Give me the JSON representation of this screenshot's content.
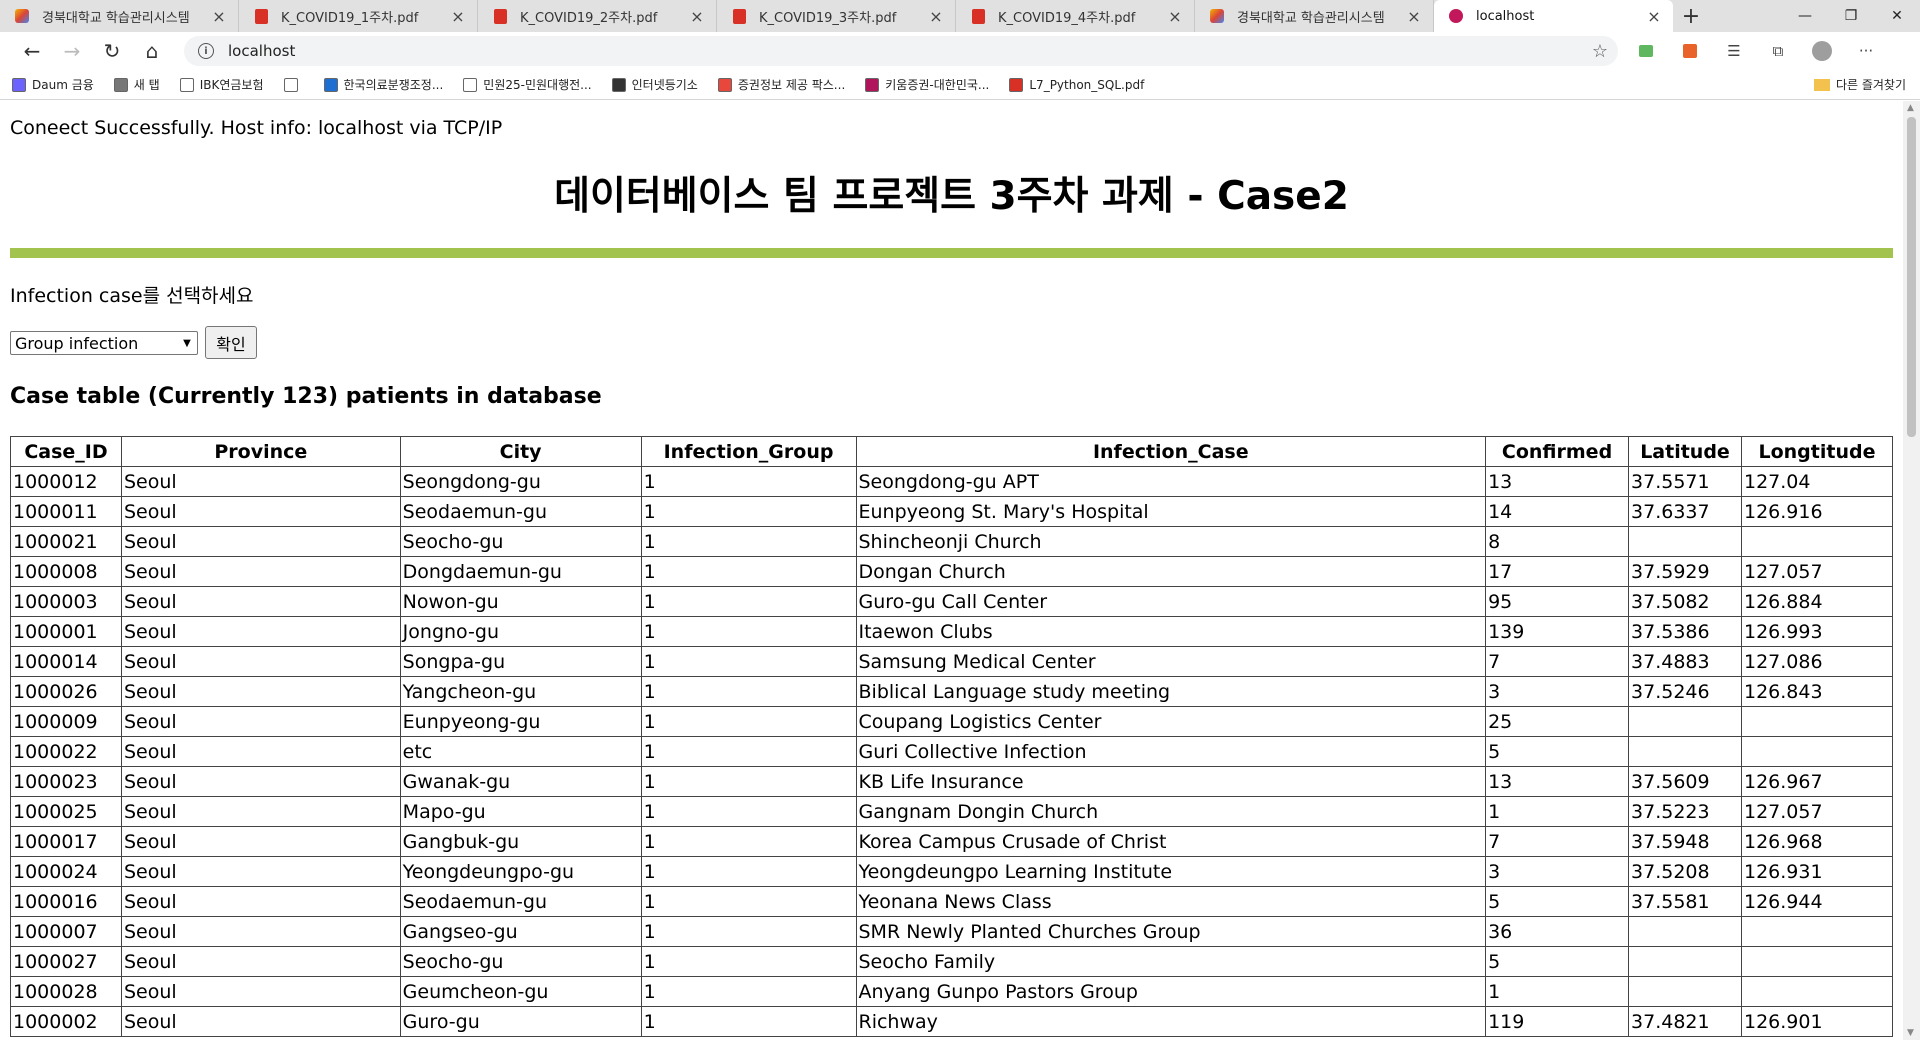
{
  "browser": {
    "tabs": [
      {
        "title": "경북대학교 학습관리시스템",
        "icon": "lms-icon",
        "active": false
      },
      {
        "title": "K_COVID19_1주차.pdf",
        "icon": "pdf-icon",
        "active": false
      },
      {
        "title": "K_COVID19_2주차.pdf",
        "icon": "pdf-icon",
        "active": false
      },
      {
        "title": "K_COVID19_3주차.pdf",
        "icon": "pdf-icon",
        "active": false
      },
      {
        "title": "K_COVID19_4주차.pdf",
        "icon": "pdf-icon",
        "active": false
      },
      {
        "title": "경북대학교 학습관리시스템",
        "icon": "lms-icon",
        "active": false
      },
      {
        "title": "localhost",
        "icon": "localhost-icon",
        "active": true
      }
    ],
    "address": "localhost",
    "bookmarks": [
      {
        "label": "Daum 금융",
        "color": "#6c63ff"
      },
      {
        "label": "새 탭",
        "color": "#777777"
      },
      {
        "label": "IBK연금보험",
        "color": "#ffffff"
      },
      {
        "label": "",
        "color": "#ffffff"
      },
      {
        "label": "한국의료분쟁조정...",
        "color": "#1d6fd1"
      },
      {
        "label": "민원25-민원대행전...",
        "color": "#ffffff"
      },
      {
        "label": "인터넷등기소",
        "color": "#333333"
      },
      {
        "label": "증권정보 제공 팍스...",
        "color": "#e8473c"
      },
      {
        "label": "키움증권-대한민국...",
        "color": "#b0145a"
      },
      {
        "label": "L7_Python_SQL.pdf",
        "color": "#d93025"
      }
    ],
    "other_bookmarks": "다른 즐겨찾기"
  },
  "page": {
    "connect_message": "Coneect Successfully. Host info: localhost via TCP/IP",
    "title": "데이터베이스 팀 프로젝트 3주차 과제 - Case2",
    "accent_color": "#a2c44f",
    "select_prompt": "Infection case를 선택하세요",
    "selected_option": "Group infection",
    "confirm_label": "확인",
    "table_heading": "Case table (Currently 123) patients in database"
  },
  "table": {
    "headers": [
      "Case_ID",
      "Province",
      "City",
      "Infection_Group",
      "Infection_Case",
      "Confirmed",
      "Latitude",
      "Longtitude"
    ],
    "rows": [
      [
        "1000012",
        "Seoul",
        "Seongdong-gu",
        "1",
        "Seongdong-gu APT",
        "13",
        "37.5571",
        "127.04"
      ],
      [
        "1000011",
        "Seoul",
        "Seodaemun-gu",
        "1",
        "Eunpyeong St. Mary's Hospital",
        "14",
        "37.6337",
        "126.916"
      ],
      [
        "1000021",
        "Seoul",
        "Seocho-gu",
        "1",
        "Shincheonji Church",
        "8",
        "",
        ""
      ],
      [
        "1000008",
        "Seoul",
        "Dongdaemun-gu",
        "1",
        "Dongan Church",
        "17",
        "37.5929",
        "127.057"
      ],
      [
        "1000003",
        "Seoul",
        "Nowon-gu",
        "1",
        "Guro-gu Call Center",
        "95",
        "37.5082",
        "126.884"
      ],
      [
        "1000001",
        "Seoul",
        "Jongno-gu",
        "1",
        "Itaewon Clubs",
        "139",
        "37.5386",
        "126.993"
      ],
      [
        "1000014",
        "Seoul",
        "Songpa-gu",
        "1",
        "Samsung Medical Center",
        "7",
        "37.4883",
        "127.086"
      ],
      [
        "1000026",
        "Seoul",
        "Yangcheon-gu",
        "1",
        "Biblical Language study meeting",
        "3",
        "37.5246",
        "126.843"
      ],
      [
        "1000009",
        "Seoul",
        "Eunpyeong-gu",
        "1",
        "Coupang Logistics Center",
        "25",
        "",
        ""
      ],
      [
        "1000022",
        "Seoul",
        "etc",
        "1",
        "Guri Collective Infection",
        "5",
        "",
        ""
      ],
      [
        "1000023",
        "Seoul",
        "Gwanak-gu",
        "1",
        "KB Life Insurance",
        "13",
        "37.5609",
        "126.967"
      ],
      [
        "1000025",
        "Seoul",
        "Mapo-gu",
        "1",
        "Gangnam Dongin Church",
        "1",
        "37.5223",
        "127.057"
      ],
      [
        "1000017",
        "Seoul",
        "Gangbuk-gu",
        "1",
        "Korea Campus Crusade of Christ",
        "7",
        "37.5948",
        "126.968"
      ],
      [
        "1000024",
        "Seoul",
        "Yeongdeungpo-gu",
        "1",
        "Yeongdeungpo Learning Institute",
        "3",
        "37.5208",
        "126.931"
      ],
      [
        "1000016",
        "Seoul",
        "Seodaemun-gu",
        "1",
        "Yeonana News Class",
        "5",
        "37.5581",
        "126.944"
      ],
      [
        "1000007",
        "Seoul",
        "Gangseo-gu",
        "1",
        "SMR Newly Planted Churches Group",
        "36",
        "",
        ""
      ],
      [
        "1000027",
        "Seoul",
        "Seocho-gu",
        "1",
        "Seocho Family",
        "5",
        "",
        ""
      ],
      [
        "1000028",
        "Seoul",
        "Geumcheon-gu",
        "1",
        "Anyang Gunpo Pastors Group",
        "1",
        "",
        ""
      ],
      [
        "1000002",
        "Seoul",
        "Guro-gu",
        "1",
        "Richway",
        "119",
        "37.4821",
        "126.901"
      ]
    ]
  }
}
